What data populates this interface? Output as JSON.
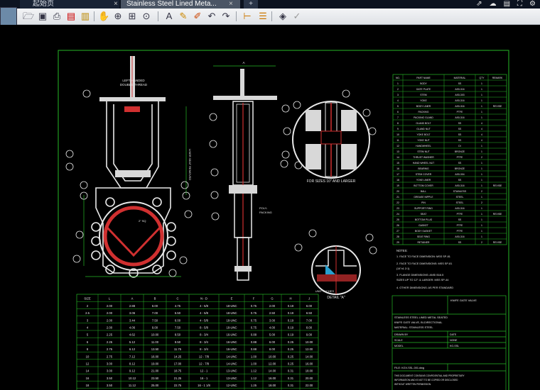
{
  "app": {
    "tabs": [
      {
        "label": "起始页"
      },
      {
        "label": "Stainless Steel Lined Meta..."
      }
    ],
    "close_glyph": "×",
    "new_tab_glyph": "+",
    "window_icons": [
      "share-icon",
      "cloud-icon",
      "layout-icon",
      "fullscreen-icon",
      "settings-icon"
    ]
  },
  "toolbar": {
    "icons": [
      "open-icon",
      "save-icon",
      "print-icon",
      "pdf-icon",
      "lock-icon",
      "pan-icon",
      "zoom-in-icon",
      "zoom-window-icon",
      "zoom-extents-icon",
      "text-icon",
      "pen-icon",
      "markup-icon",
      "undo-icon",
      "redo-icon",
      "measure-icon",
      "layer-icon",
      "layers-icon",
      "check-icon"
    ]
  },
  "drawing": {
    "view_labels": {
      "section_label": "FOR SIZES 10\" AND LARGER",
      "detail_label": "DETAIL \"A\"",
      "left_note_1": "LEFT HANDED",
      "left_note_2": "DOUBLE THREAD",
      "side_note": "LINER SEAT REMOVED",
      "flange_note": "2\" SQ",
      "right_note_1": "POLY-",
      "right_note_2": "PACKING",
      "dim_top": "A",
      "dim_bot": "B"
    },
    "bom": {
      "headers": [
        "NO.",
        "PART NAME",
        "MATERIAL",
        "QTY",
        "REMARK"
      ],
      "rows": [
        [
          "1",
          "BODY",
          "SS",
          "1",
          ""
        ],
        [
          "2",
          "GATE PLATE",
          "AISI-316",
          "1",
          ""
        ],
        [
          "3",
          "STEM",
          "AISI-303",
          "1",
          ""
        ],
        [
          "4",
          "YOKE",
          "AISI-316",
          "1",
          ""
        ],
        [
          "5",
          "BODY LINER",
          "AISI-316",
          "1",
          "REVISE"
        ],
        [
          "6",
          "PACKING",
          "PTFE",
          "1",
          ""
        ],
        [
          "7",
          "PACKING GLAND",
          "AISI-316",
          "1",
          ""
        ],
        [
          "8",
          "GLAND BOLT",
          "SS",
          "4",
          ""
        ],
        [
          "9",
          "GLAND NUT",
          "SS",
          "4",
          ""
        ],
        [
          "10",
          "YOKE BOLT",
          "SS",
          "4",
          ""
        ],
        [
          "11",
          "YOKE NUT",
          "SS",
          "4",
          ""
        ],
        [
          "12",
          "HANDWHEEL",
          "DI",
          "1",
          ""
        ],
        [
          "13",
          "STEM NUT",
          "BRONZE",
          "1",
          ""
        ],
        [
          "14",
          "THRUST WASHER",
          "PTFE",
          "2",
          ""
        ],
        [
          "15",
          "HAND WHEEL NUT",
          "SS",
          "1",
          ""
        ],
        [
          "16",
          "BEARING",
          "BRONZE",
          "1",
          ""
        ],
        [
          "17",
          "STEM COVER",
          "AISI-304",
          "1",
          ""
        ],
        [
          "18",
          "YOKE LINER",
          "SS",
          "1",
          ""
        ],
        [
          "19",
          "BOTTOM COVER",
          "AISI-316",
          "1",
          "REVISE"
        ],
        [
          "20",
          "BALL",
          "STAINLESS",
          "2",
          ""
        ],
        [
          "21",
          "GREASE NIPPLE",
          "STEEL",
          "1",
          ""
        ],
        [
          "22",
          "PIN",
          "STEEL",
          "2",
          ""
        ],
        [
          "23",
          "SUPPORT RING",
          "AISI-316",
          "1",
          ""
        ],
        [
          "24",
          "SEAT",
          "PTFE",
          "1",
          "REVISE"
        ],
        [
          "25",
          "BOTTOM PLUG",
          "SS",
          "1",
          ""
        ],
        [
          "26",
          "GASKET",
          "PTFE",
          "1",
          ""
        ],
        [
          "27",
          "BODY GASKET",
          "PTFE",
          "1",
          ""
        ],
        [
          "28",
          "SEAT RING",
          "AISI-316",
          "1",
          ""
        ],
        [
          "29",
          "RETAINER",
          "SS",
          "2",
          "REVISE"
        ]
      ]
    },
    "notes": {
      "title": "NOTES:",
      "lines": [
        "1. FACE TO FACE DIMENSION: MSS SP-81",
        "2. FACE TO FACE DIMENSIONS: MSS SP-81",
        "   (14\"x1 2:1)",
        "3. FLANGE DIMENSIONS: ANSI B16.5",
        "   SIZES UP TO 12\": & LARGER: MSS SP-44",
        "4. OTHER DIMENSIONS: AS PER STANDARD"
      ]
    },
    "title_block": {
      "company": "KNIFE GATE VALVE",
      "title_lines": [
        "STAINLESS STEEL LINED METAL SEATED",
        "KNIFE GATE VALVE, BI-DIRECTIONAL",
        "MATERIAL: STAINLESS STEEL"
      ],
      "fields": [
        [
          "DRAWN BY",
          "DATE"
        ],
        [
          "SCALE",
          "NONE"
        ],
        [
          "MODEL",
          "KG-SSL"
        ]
      ],
      "file_label": "FILE: KGV-SSL-001.dwg",
      "footer_lines": [
        "THIS DOCUMENT CONTAINS CONFIDENTIAL AND PROPRIETARY",
        "INFORMATION AND IS NOT TO BE COPIED OR DISCLOSED",
        "WITHOUT WRITTEN PERMISSION."
      ]
    },
    "dim_table": {
      "caption": "UNIT: INCHES",
      "headers": [
        "SIZE",
        "L",
        "A",
        "B",
        "C",
        "N - D",
        "E",
        "F",
        "G",
        "H",
        "J"
      ],
      "rows": [
        [
          "2",
          "2.00",
          "2.88",
          "6.00",
          "4.75",
          "4 - 5/8",
          "18-UNC",
          "0.75",
          "2.00",
          "0.19",
          "6.00"
        ],
        [
          "2.5",
          "2.00",
          "3.06",
          "7.00",
          "5.50",
          "4 - 5/8",
          "18-UNC",
          "0.75",
          "2.50",
          "0.19",
          "6.50"
        ],
        [
          "3",
          "2.00",
          "3.44",
          "7.50",
          "6.00",
          "4 - 5/8",
          "18-UNC",
          "0.75",
          "3.00",
          "0.19",
          "7.00"
        ],
        [
          "4",
          "2.00",
          "4.06",
          "9.00",
          "7.50",
          "8 - 5/8",
          "18-UNC",
          "0.75",
          "4.00",
          "0.19",
          "8.00"
        ],
        [
          "5",
          "2.25",
          "4.62",
          "10.00",
          "8.50",
          "8 - 3/4",
          "16-UNC",
          "0.88",
          "5.00",
          "0.19",
          "9.00"
        ],
        [
          "6",
          "2.25",
          "5.12",
          "11.00",
          "9.50",
          "8 - 3/4",
          "16-UNC",
          "0.88",
          "6.00",
          "0.25",
          "10.00"
        ],
        [
          "8",
          "2.75",
          "6.12",
          "13.50",
          "11.75",
          "8 - 3/4",
          "16-UNC",
          "0.88",
          "8.00",
          "0.25",
          "12.00"
        ],
        [
          "10",
          "2.75",
          "7.12",
          "16.00",
          "14.25",
          "12 - 7/8",
          "14-UNC",
          "1.00",
          "10.00",
          "0.25",
          "14.00"
        ],
        [
          "12",
          "3.00",
          "8.12",
          "19.00",
          "17.00",
          "12 - 7/8",
          "14-UNC",
          "1.00",
          "12.00",
          "0.25",
          "16.00"
        ],
        [
          "14",
          "3.00",
          "9.12",
          "21.00",
          "18.75",
          "12 - 1",
          "13-UNC",
          "1.12",
          "14.00",
          "0.31",
          "18.00"
        ],
        [
          "16",
          "3.50",
          "10.12",
          "23.50",
          "21.25",
          "16 - 1",
          "13-UNC",
          "1.12",
          "16.00",
          "0.31",
          "20.00"
        ],
        [
          "18",
          "3.50",
          "11.12",
          "25.00",
          "22.75",
          "16 - 1 1/8",
          "12-UNC",
          "1.25",
          "18.00",
          "0.31",
          "22.00"
        ],
        [
          "20",
          "4.50",
          "12.12",
          "27.50",
          "25.00",
          "20 - 1 1/8",
          "12-UNC",
          "1.25",
          "20.00",
          "0.38",
          "24.00"
        ],
        [
          "24",
          "4.50",
          "14.12",
          "32.00",
          "29.50",
          "20 - 1 1/4",
          "12-UNC",
          "1.38",
          "24.00",
          "0.38",
          "28.00"
        ]
      ]
    }
  },
  "colors": {
    "frame": "#26b826",
    "part_outline": "#e8e8e8",
    "hatch": "#d03030",
    "balloon": "#e8e8e8"
  }
}
